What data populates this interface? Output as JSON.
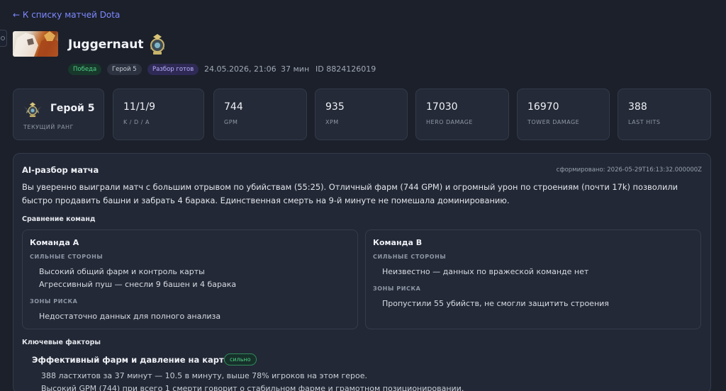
{
  "nav": {
    "back_label": "← К списку матчей Dota"
  },
  "hero": {
    "name": "Juggernaut",
    "portrait_icon": "juggernaut-portrait",
    "rank_icon": "rank-emblem"
  },
  "match": {
    "badges": {
      "result": "Победа",
      "hero_rank": "Герой 5",
      "analysis_status": "Разбор готов"
    },
    "date": "24.05.2026, 21:06",
    "duration": "37 мин",
    "id": "ID 8824126019"
  },
  "stats": {
    "rank": {
      "value": "Герой 5",
      "label": "ТЕКУЩИЙ РАНГ"
    },
    "kda": {
      "value": "11/1/9",
      "label": "K / D / A"
    },
    "gpm": {
      "value": "744",
      "label": "GPM"
    },
    "xpm": {
      "value": "935",
      "label": "XPM"
    },
    "hero_damage": {
      "value": "17030",
      "label": "HERO DAMAGE"
    },
    "tower_damage": {
      "value": "16970",
      "label": "TOWER DAMAGE"
    },
    "last_hits": {
      "value": "388",
      "label": "LAST HITS"
    }
  },
  "analysis": {
    "title": "AI-разбор матча",
    "generated": "сформировано: 2026-05-29T16:13:32.000000Z",
    "summary": "Вы уверенно выиграли матч с большим отрывом по убийствам (55:25). Отличный фарм (744 GPM) и огромный урон по строениям (почти 17k) позволили быстро продавить башни и забрать 4 барака. Единственная смерть на 9-й минуте не помешала доминированию.",
    "comparison_heading": "Сравнение команд",
    "team_a": {
      "title": "Команда A",
      "strengths_label": "СИЛЬНЫЕ СТОРОНЫ",
      "strengths": [
        "Высокий общий фарм и контроль карты",
        "Агрессивный пуш — снесли 9 башен и 4 барака"
      ],
      "risks_label": "ЗОНЫ РИСКА",
      "risks": [
        "Недостаточно данных для полного анализа"
      ]
    },
    "team_b": {
      "title": "Команда B",
      "strengths_label": "СИЛЬНЫЕ СТОРОНЫ",
      "strengths": [
        "Неизвестно — данных по вражеской команде нет"
      ],
      "risks_label": "ЗОНЫ РИСКА",
      "risks": [
        "Пропустили 55 убийств, не смогли защитить строения"
      ]
    },
    "factors_heading": "Ключевые факторы",
    "factors": [
      {
        "title": "Эффективный фарм и давление на карте",
        "badge": "сильно",
        "lines": [
          "388 ластхитов за 37 минут — 10.5 в минуту, выше 78% игроков на этом герое.",
          "Высокий GPM (744) при всего 1 смерти говорит о стабильном фарме и грамотном позиционировании."
        ]
      }
    ]
  },
  "colors": {
    "background": "#1b202b",
    "card": "#242a37",
    "accent_link": "#7e89ff",
    "win_green": "#52d189",
    "ready_purple": "#b7b0ff"
  }
}
